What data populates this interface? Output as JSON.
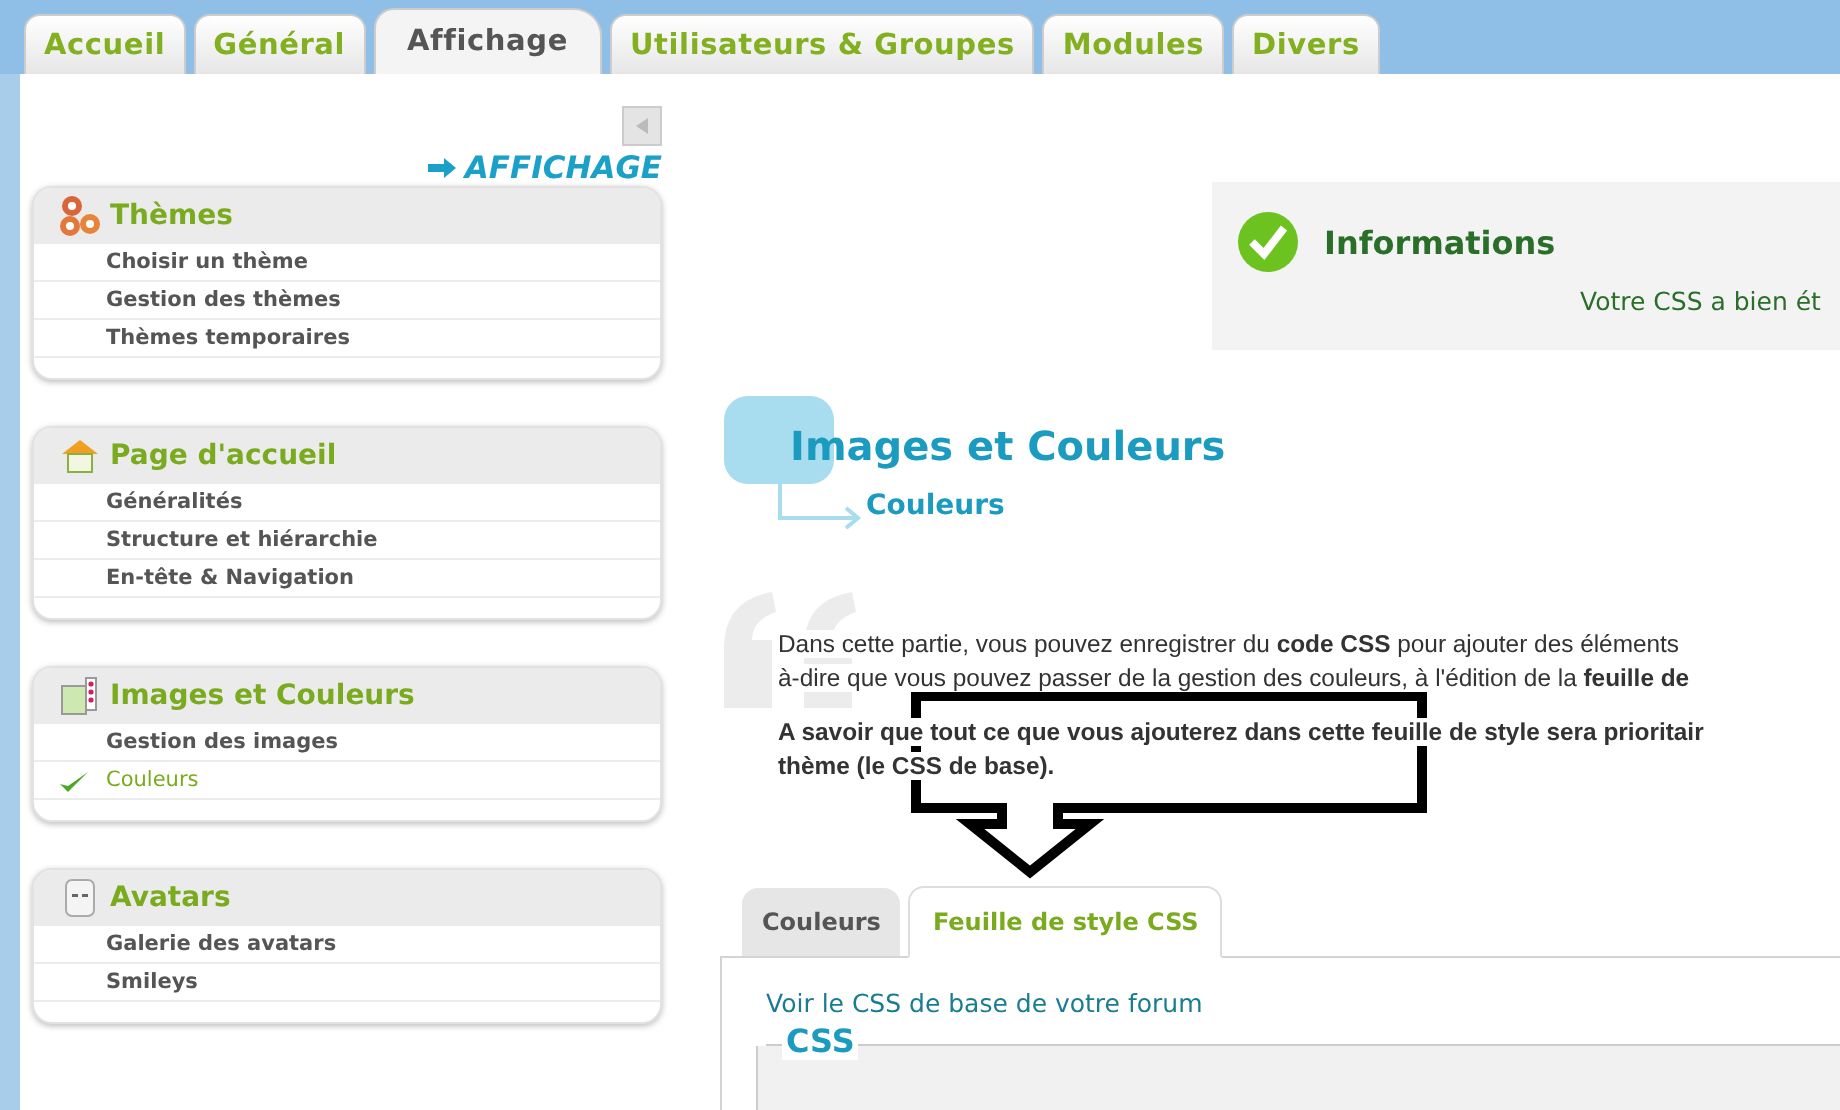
{
  "tabs": [
    {
      "label": "Accueil",
      "selected": false
    },
    {
      "label": "Général",
      "selected": false
    },
    {
      "label": "Affichage",
      "selected": true
    },
    {
      "label": "Utilisateurs & Groupes",
      "selected": false
    },
    {
      "label": "Modules",
      "selected": false
    },
    {
      "label": "Divers",
      "selected": false
    }
  ],
  "sidebar": {
    "heading": "AFFICHAGE",
    "sections": [
      {
        "title": "Thèmes",
        "items": [
          {
            "label": "Choisir un thème",
            "selected": false
          },
          {
            "label": "Gestion des thèmes",
            "selected": false
          },
          {
            "label": "Thèmes temporaires",
            "selected": false
          }
        ]
      },
      {
        "title": "Page d'accueil",
        "items": [
          {
            "label": "Généralités",
            "selected": false
          },
          {
            "label": "Structure et hiérarchie",
            "selected": false
          },
          {
            "label": "En-tête & Navigation",
            "selected": false
          }
        ]
      },
      {
        "title": "Images et Couleurs",
        "items": [
          {
            "label": "Gestion des images",
            "selected": false
          },
          {
            "label": "Couleurs",
            "selected": true
          }
        ]
      },
      {
        "title": "Avatars",
        "items": [
          {
            "label": "Galerie des avatars",
            "selected": false
          },
          {
            "label": "Smileys",
            "selected": false
          }
        ]
      }
    ]
  },
  "info": {
    "title": "Informations",
    "message": "Votre CSS a bien ét"
  },
  "page": {
    "title": "Images et Couleurs",
    "subtitle": "Couleurs"
  },
  "intro": [
    {
      "kind": "text",
      "lines": [
        "Dans cette partie, vous pouvez enregistrer du **code CSS** pour ajouter des éléments",
        "à-dire que vous pouvez passer de la gestion des couleurs, à l'édition de la **feuille de**"
      ]
    },
    {
      "kind": "note",
      "lines": [
        "A savoir que tout ce que vous ajouterez dans cette feuille de style sera prioritair",
        "thème (le CSS de base)."
      ]
    }
  ],
  "subtabs": [
    {
      "label": "Couleurs",
      "selected": false
    },
    {
      "label": "Feuille de style CSS",
      "selected": true
    }
  ],
  "panel": {
    "link": "Voir le CSS de base de votre forum",
    "legend": "CSS"
  }
}
